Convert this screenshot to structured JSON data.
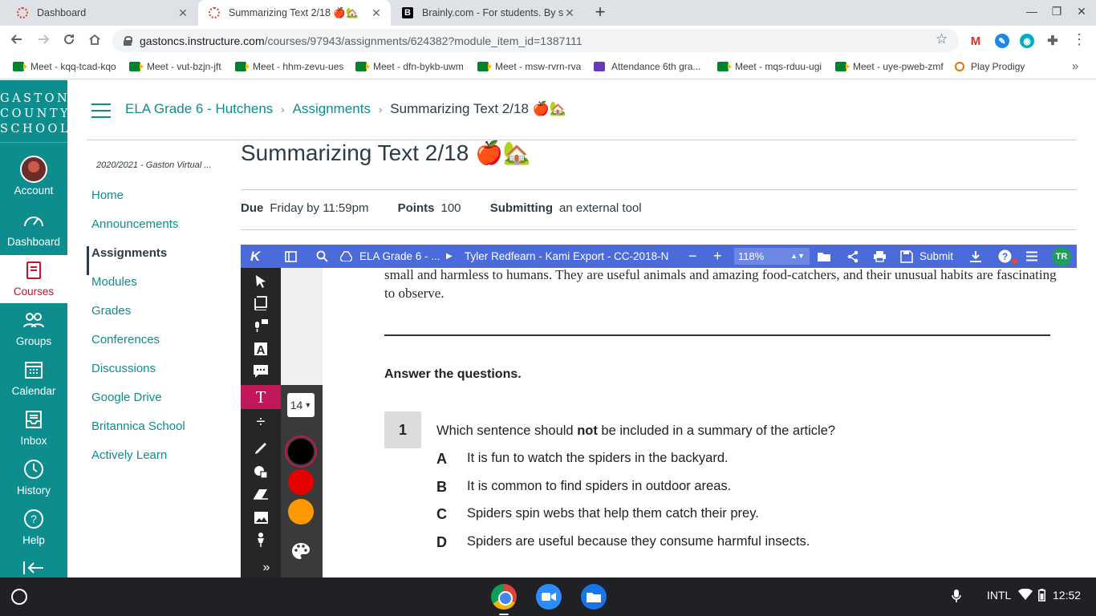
{
  "browser": {
    "tabs": [
      {
        "title": "Dashboard",
        "icon": "canvas-icon",
        "active": false
      },
      {
        "title": "Summarizing Text 2/18 🍎🏡",
        "icon": "canvas-icon",
        "active": true
      },
      {
        "title": "Brainly.com - For students. By st",
        "icon": "brainly-icon",
        "active": false
      }
    ],
    "url_host": "gastoncs.instructure.com",
    "url_path": "/courses/97943/assignments/624382?module_item_id=1387111",
    "bookmarks": [
      {
        "label": "Meet - kqq-tcad-kqo",
        "icon": "meet-icon"
      },
      {
        "label": "Meet - vut-bzjn-jft",
        "icon": "meet-icon"
      },
      {
        "label": "Meet - hhm-zevu-ues",
        "icon": "meet-icon"
      },
      {
        "label": "Meet - dfn-bykb-uwm",
        "icon": "meet-icon"
      },
      {
        "label": "Meet - msw-rvrn-rva",
        "icon": "meet-icon"
      },
      {
        "label": "Attendance 6th gra...",
        "icon": "forms-icon"
      },
      {
        "label": "Meet - mqs-rduu-ugi",
        "icon": "meet-icon"
      },
      {
        "label": "Meet - uye-pweb-zmf",
        "icon": "meet-icon"
      },
      {
        "label": "Play Prodigy",
        "icon": "prodigy-icon"
      }
    ]
  },
  "canvas": {
    "logo_lines": [
      "GASTON",
      "COUNTY",
      "SCHOOLS"
    ],
    "global_nav": [
      {
        "label": "Account",
        "icon": "avatar-icon"
      },
      {
        "label": "Dashboard",
        "icon": "dashboard-icon"
      },
      {
        "label": "Courses",
        "icon": "courses-icon"
      },
      {
        "label": "Groups",
        "icon": "groups-icon"
      },
      {
        "label": "Calendar",
        "icon": "calendar-icon"
      },
      {
        "label": "Inbox",
        "icon": "inbox-icon"
      },
      {
        "label": "History",
        "icon": "history-icon"
      },
      {
        "label": "Help",
        "icon": "help-icon"
      }
    ],
    "breadcrumb": {
      "course": "ELA Grade 6 - Hutchens",
      "section": "Assignments",
      "current": "Summarizing Text 2/18 🍎🏡"
    },
    "term": "2020/2021 - Gaston Virtual ...",
    "course_nav": [
      "Home",
      "Announcements",
      "Assignments",
      "Modules",
      "Grades",
      "Conferences",
      "Discussions",
      "Google Drive",
      "Britannica School",
      "Actively Learn"
    ],
    "active_course_nav": "Assignments",
    "assignment": {
      "title": "Summarizing Text 2/18 🍎🏡",
      "due_label": "Due",
      "due_value": "Friday by 11:59pm",
      "points_label": "Points",
      "points_value": "100",
      "submitting_label": "Submitting",
      "submitting_value": "an external tool"
    }
  },
  "kami": {
    "folder": "ELA Grade 6 - ...",
    "file": "Tyler Redfearn - Kami Export - CC-2018-N",
    "zoom": "118%",
    "submit_label": "Submit",
    "user_initials": "TR",
    "font_size": "14",
    "colors": [
      "#000000",
      "#e60000",
      "#ff9900"
    ],
    "accent": "#4a6bd9"
  },
  "document": {
    "intro": "small and harmless to humans. They are useful animals and amazing food-catchers, and their unusual habits are fascinating to observe.",
    "heading": "Answer the questions.",
    "question_number": "1",
    "question_before": "Which sentence should ",
    "question_bold": "not",
    "question_after": " be included in a summary of the article?",
    "options": [
      {
        "letter": "A",
        "text": "It is fun to watch the spiders in the backyard."
      },
      {
        "letter": "B",
        "text": "It is common to find spiders in outdoor areas."
      },
      {
        "letter": "C",
        "text": "Spiders spin webs that help them catch their prey."
      },
      {
        "letter": "D",
        "text": "Spiders are useful because they consume harmful insects."
      }
    ]
  },
  "shelf": {
    "input_method": "INTL",
    "time": "12:52"
  }
}
